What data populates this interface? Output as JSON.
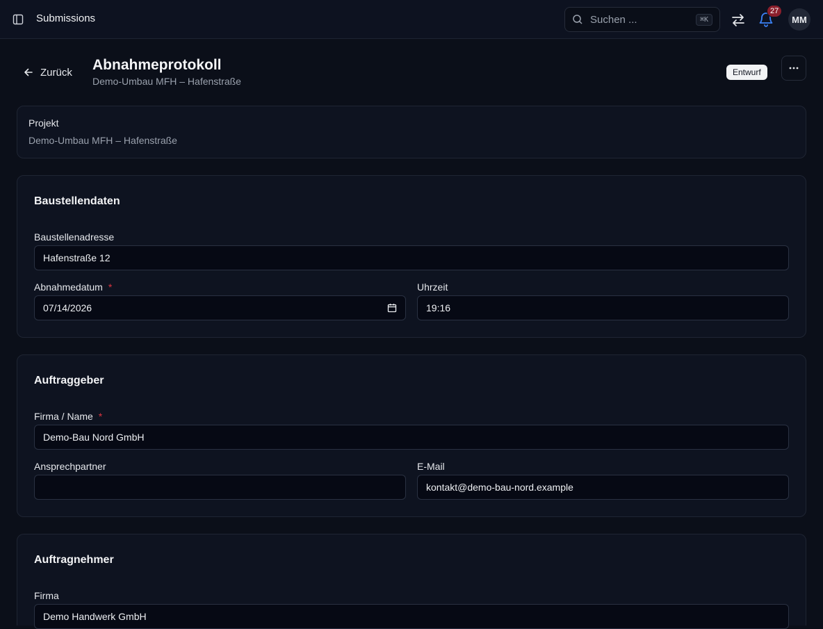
{
  "header": {
    "app_title": "Submissions",
    "search_placeholder": "Suchen ...",
    "search_shortcut": "⌘K",
    "notification_count": "27",
    "avatar_initials": "MM"
  },
  "page": {
    "back_label": "Zurück",
    "title": "Abnahmeprotokoll",
    "subtitle": "Demo-Umbau MFH – Hafenstraße",
    "status": "Entwurf"
  },
  "project_card": {
    "label": "Projekt",
    "value": "Demo-Umbau MFH – Hafenstraße"
  },
  "site_card": {
    "title": "Baustellendaten",
    "address_label": "Baustellenadresse",
    "address_value": "Hafenstraße 12",
    "date_label": "Abnahmedatum",
    "date_value": "07/14/2026",
    "time_label": "Uhrzeit",
    "time_value": "19:16",
    "required_mark": "*"
  },
  "client_card": {
    "title": "Auftraggeber",
    "company_label": "Firma / Name",
    "company_value": "Demo-Bau Nord GmbH",
    "contact_label": "Ansprechpartner",
    "contact_value": "",
    "email_label": "E-Mail",
    "email_value": "kontakt@demo-bau-nord.example",
    "required_mark": "*"
  },
  "contractor_card": {
    "title": "Auftragnehmer",
    "company_label": "Firma",
    "company_value": "Demo Handwerk GmbH"
  }
}
